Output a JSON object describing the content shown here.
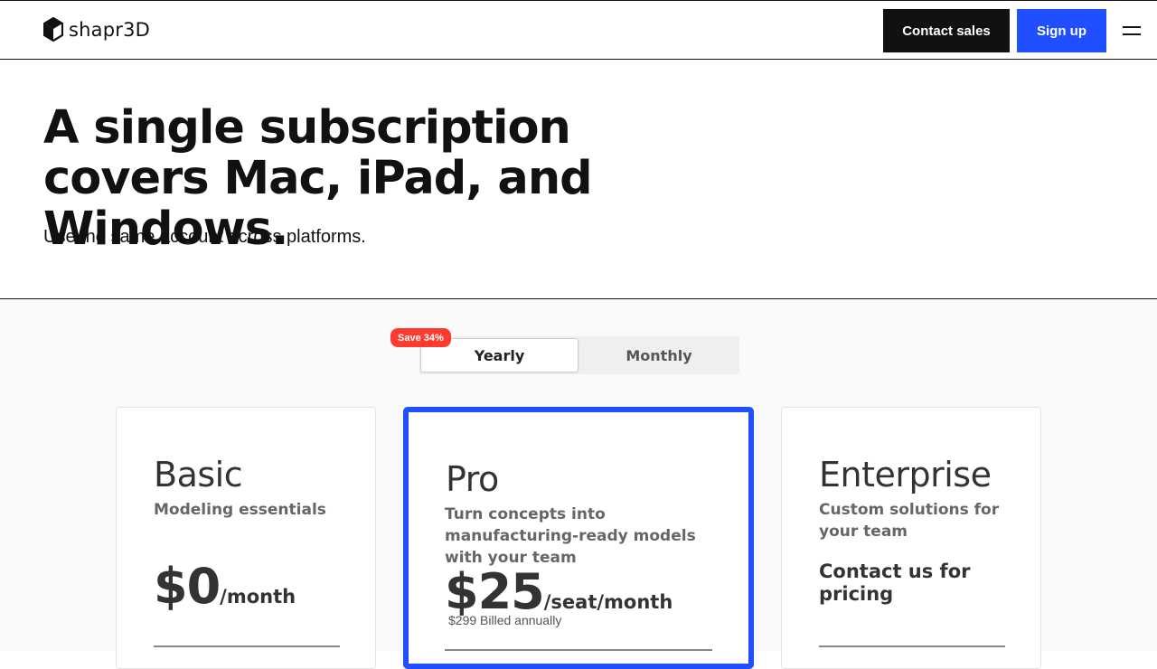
{
  "header": {
    "logo_text": "shapr3D",
    "contact_label": "Contact sales",
    "signup_label": "Sign up",
    "menu_icon": "hamburger-menu-icon"
  },
  "hero": {
    "title": "A single subscription covers Mac, iPad, and Windows.",
    "subtitle": "Use the same account across platforms."
  },
  "billing_toggle": {
    "save_badge": "Save 34%",
    "yearly_label": "Yearly",
    "monthly_label": "Monthly",
    "selected": "Yearly"
  },
  "plans": [
    {
      "name": "Basic",
      "description": "Modeling essentials",
      "price": "$0",
      "unit": "/month"
    },
    {
      "name": "Pro",
      "description": "Turn concepts into manufacturing-ready models with your team",
      "price": "$25",
      "unit": "/seat/month",
      "billed": "$299 Billed annually"
    },
    {
      "name": "Enterprise",
      "description": "Custom solutions for your team",
      "contact": "Contact us for pricing"
    }
  ],
  "colors": {
    "brand_blue": "#1f4fff",
    "badge_red": "#ff3b30",
    "dark": "#111111"
  }
}
